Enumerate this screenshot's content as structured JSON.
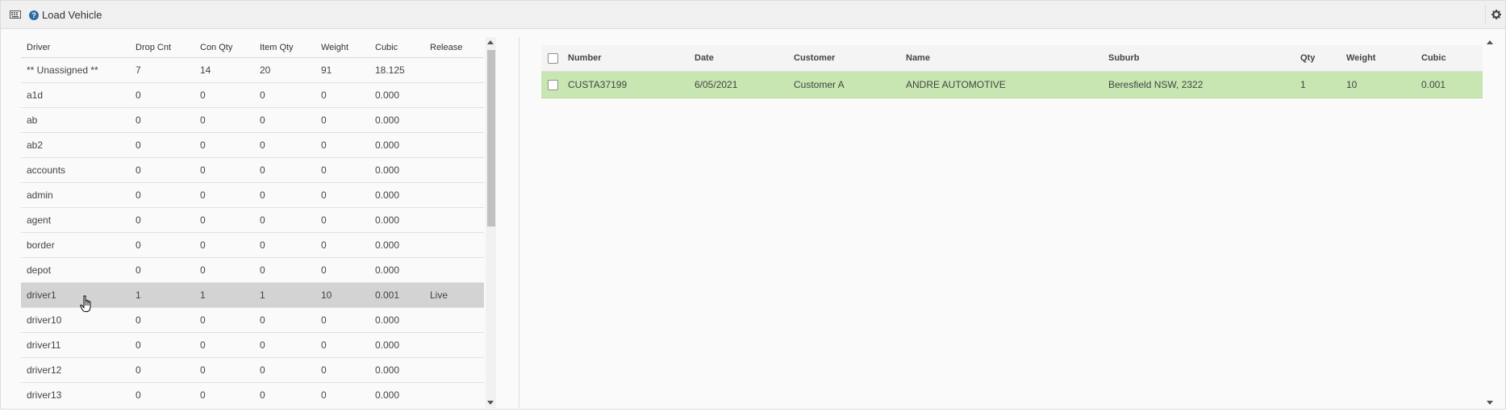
{
  "header": {
    "title": "Load Vehicle",
    "help_glyph": "?",
    "icons": [
      "keyboard-icon",
      "help-icon",
      "gear-icon"
    ]
  },
  "drivers_table": {
    "columns": [
      "Driver",
      "Drop Cnt",
      "Con Qty",
      "Item Qty",
      "Weight",
      "Cubic",
      "Release"
    ],
    "rows": [
      {
        "driver": "** Unassigned **",
        "drop_cnt": "7",
        "con_qty": "14",
        "item_qty": "20",
        "weight": "91",
        "cubic": "18.125",
        "release": ""
      },
      {
        "driver": "a1d",
        "drop_cnt": "0",
        "con_qty": "0",
        "item_qty": "0",
        "weight": "0",
        "cubic": "0.000",
        "release": ""
      },
      {
        "driver": "ab",
        "drop_cnt": "0",
        "con_qty": "0",
        "item_qty": "0",
        "weight": "0",
        "cubic": "0.000",
        "release": ""
      },
      {
        "driver": "ab2",
        "drop_cnt": "0",
        "con_qty": "0",
        "item_qty": "0",
        "weight": "0",
        "cubic": "0.000",
        "release": ""
      },
      {
        "driver": "accounts",
        "drop_cnt": "0",
        "con_qty": "0",
        "item_qty": "0",
        "weight": "0",
        "cubic": "0.000",
        "release": ""
      },
      {
        "driver": "admin",
        "drop_cnt": "0",
        "con_qty": "0",
        "item_qty": "0",
        "weight": "0",
        "cubic": "0.000",
        "release": ""
      },
      {
        "driver": "agent",
        "drop_cnt": "0",
        "con_qty": "0",
        "item_qty": "0",
        "weight": "0",
        "cubic": "0.000",
        "release": ""
      },
      {
        "driver": "border",
        "drop_cnt": "0",
        "con_qty": "0",
        "item_qty": "0",
        "weight": "0",
        "cubic": "0.000",
        "release": ""
      },
      {
        "driver": "depot",
        "drop_cnt": "0",
        "con_qty": "0",
        "item_qty": "0",
        "weight": "0",
        "cubic": "0.000",
        "release": ""
      },
      {
        "driver": "driver1",
        "drop_cnt": "1",
        "con_qty": "1",
        "item_qty": "1",
        "weight": "10",
        "cubic": "0.001",
        "release": "Live",
        "selected": true
      },
      {
        "driver": "driver10",
        "drop_cnt": "0",
        "con_qty": "0",
        "item_qty": "0",
        "weight": "0",
        "cubic": "0.000",
        "release": ""
      },
      {
        "driver": "driver11",
        "drop_cnt": "0",
        "con_qty": "0",
        "item_qty": "0",
        "weight": "0",
        "cubic": "0.000",
        "release": ""
      },
      {
        "driver": "driver12",
        "drop_cnt": "0",
        "con_qty": "0",
        "item_qty": "0",
        "weight": "0",
        "cubic": "0.000",
        "release": ""
      },
      {
        "driver": "driver13",
        "drop_cnt": "0",
        "con_qty": "0",
        "item_qty": "0",
        "weight": "0",
        "cubic": "0.000",
        "release": ""
      }
    ]
  },
  "consignments_table": {
    "columns": [
      "Number",
      "Date",
      "Customer",
      "Name",
      "Suburb",
      "Qty",
      "Weight",
      "Cubic"
    ],
    "rows": [
      {
        "number": "CUSTA37199",
        "date": "6/05/2021",
        "customer": "Customer A",
        "name": "ANDRE AUTOMOTIVE",
        "suburb": "Beresfield NSW, 2322",
        "qty": "1",
        "weight": "10",
        "cubic": "0.001"
      }
    ]
  },
  "colors": {
    "selected_driver_row": "#d3d3d3",
    "consignment_row": "#c8e6b1",
    "help_icon": "#2d6ca2"
  }
}
